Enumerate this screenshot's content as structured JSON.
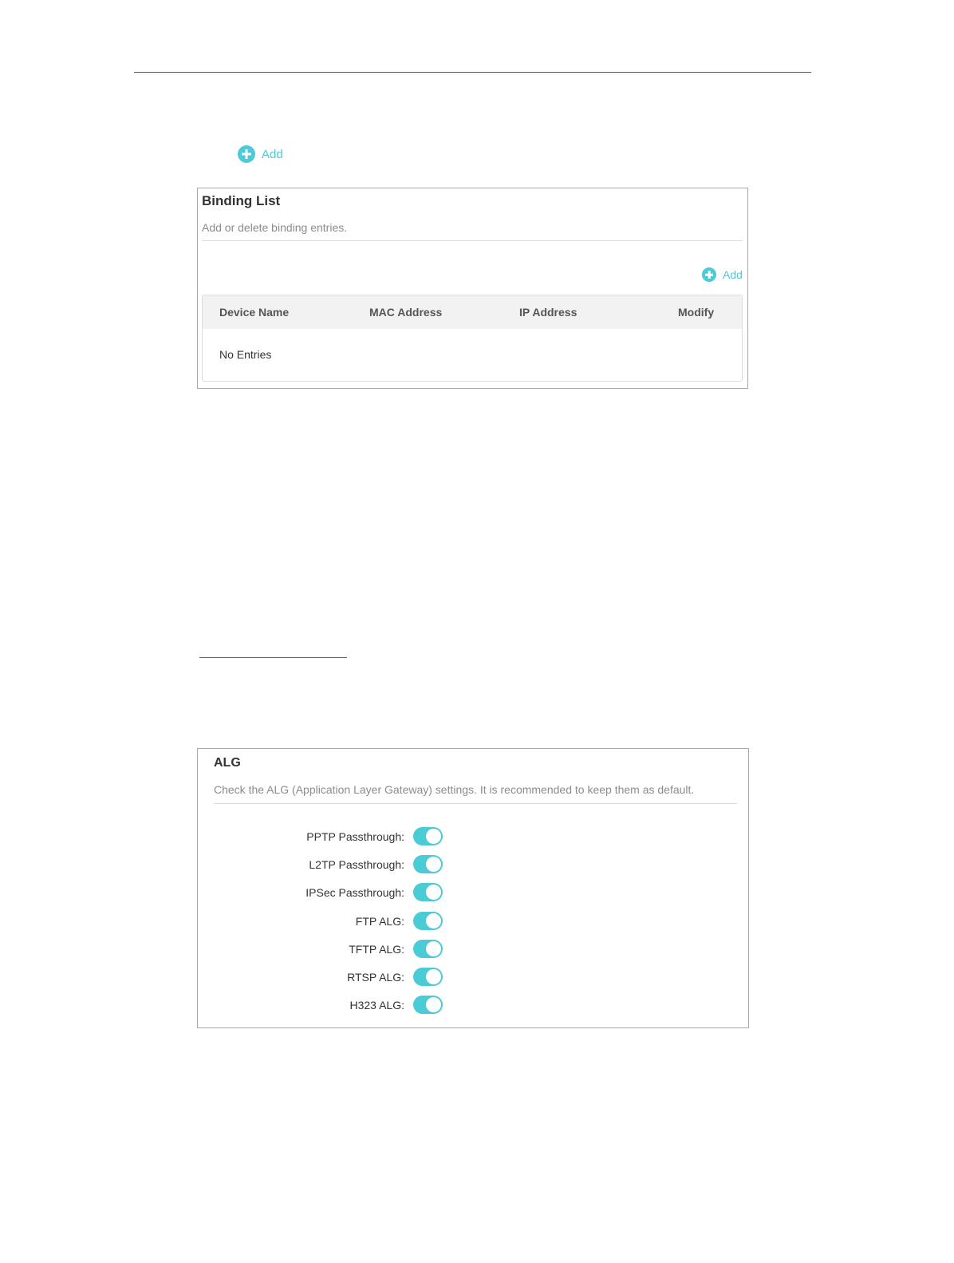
{
  "top_add": {
    "label": "Add"
  },
  "binding": {
    "title": "Binding List",
    "description": "Add or delete binding entries.",
    "add_label": "Add",
    "columns": [
      "Device Name",
      "MAC Address",
      "IP Address",
      "Modify"
    ],
    "empty_text": "No Entries"
  },
  "alg": {
    "title": "ALG",
    "description": "Check the ALG (Application Layer Gateway) settings. It is recommended to keep them as default.",
    "items": [
      {
        "label": "PPTP Passthrough:",
        "enabled": true
      },
      {
        "label": "L2TP Passthrough:",
        "enabled": true
      },
      {
        "label": "IPSec Passthrough:",
        "enabled": true
      },
      {
        "label": "FTP ALG:",
        "enabled": true
      },
      {
        "label": "TFTP ALG:",
        "enabled": true
      },
      {
        "label": "RTSP ALG:",
        "enabled": true
      },
      {
        "label": "H323 ALG:",
        "enabled": true
      }
    ]
  },
  "colors": {
    "accent": "#4acbd6",
    "border": "#a9a9a9"
  }
}
